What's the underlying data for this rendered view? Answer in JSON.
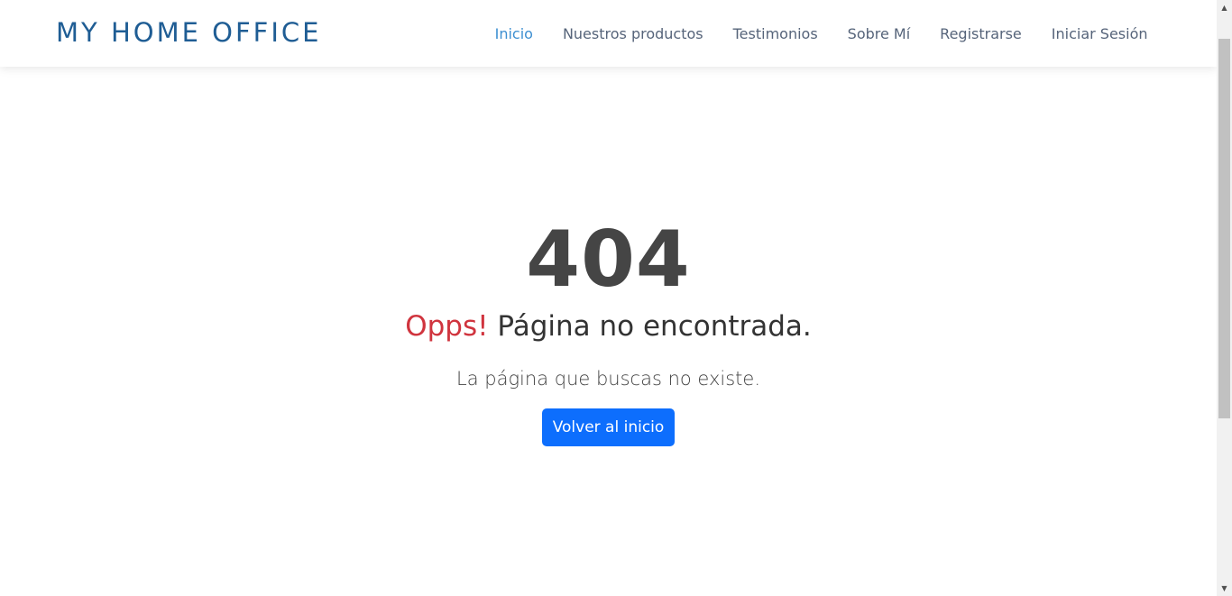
{
  "brand": {
    "name": "MY HOME OFFICE",
    "color": "#1f5d94"
  },
  "nav": {
    "items": [
      {
        "label": "Inicio",
        "active": true
      },
      {
        "label": "Nuestros productos",
        "active": false
      },
      {
        "label": "Testimonios",
        "active": false
      },
      {
        "label": "Sobre Mí",
        "active": false
      },
      {
        "label": "Registrarse",
        "active": false
      },
      {
        "label": "Iniciar Sesión",
        "active": false
      }
    ],
    "active_color": "#3d8fd1",
    "color": "#56647a"
  },
  "error": {
    "code": "404",
    "oops": "Opps!",
    "title": "Página no encontrada.",
    "description": "La página que buscas no existe.",
    "button_label": "Volver al inicio",
    "oops_color": "#d0343e",
    "button_color": "#0d6efd"
  },
  "scrollbar": {
    "up_icon": "triangle-up-icon",
    "down_icon": "triangle-down-icon"
  }
}
